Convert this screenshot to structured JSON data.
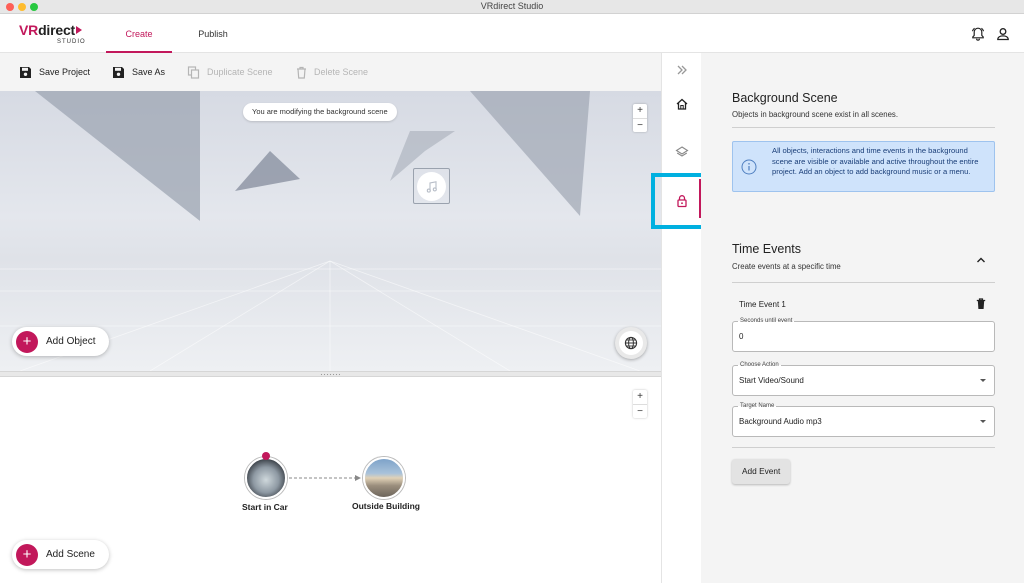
{
  "window": {
    "title": "VRdirect Studio"
  },
  "brand": {
    "name_prefix": "VR",
    "name_rest": "direct",
    "sub": "STUDIO",
    "accent": "#c2185b"
  },
  "header": {
    "tabs": [
      {
        "label": "Create",
        "active": true
      },
      {
        "label": "Publish",
        "active": false
      }
    ],
    "icons": [
      "bell-icon",
      "user-icon"
    ]
  },
  "toolbar": {
    "save_project": "Save Project",
    "save_as": "Save As",
    "duplicate_scene": "Duplicate Scene",
    "delete_scene": "Delete Scene"
  },
  "viewport": {
    "notice": "You are modifying the background scene",
    "zoom_in": "+",
    "zoom_out": "−",
    "add_object": "Add Object",
    "plus": "+"
  },
  "graph": {
    "zoom_in": "+",
    "zoom_out": "−",
    "nodes": [
      {
        "label": "Start in Car"
      },
      {
        "label": "Outside Building"
      }
    ],
    "add_scene": "Add Scene",
    "plus": "+"
  },
  "panel": {
    "background_scene": {
      "title": "Background Scene",
      "subtitle": "Objects in background scene exist in all scenes.",
      "info": "All objects, interactions and time events in the background scene are visible or available and active throughout the entire project. Add an object to add background music or a menu."
    },
    "time_events": {
      "title": "Time Events",
      "subtitle": "Create events at a specific time",
      "event": {
        "title": "Time Event 1",
        "seconds_label": "Seconds until event",
        "seconds_value": "0",
        "action_label": "Choose Action",
        "action_value": "Start Video/Sound",
        "target_label": "Target Name",
        "target_value": "Background Audio mp3"
      },
      "add_event": "Add Event"
    }
  },
  "colors": {
    "accent": "#c2185b",
    "highlight": "#00b0e0",
    "info_bg": "#cfe3fb",
    "info_text": "#1a3e78"
  }
}
